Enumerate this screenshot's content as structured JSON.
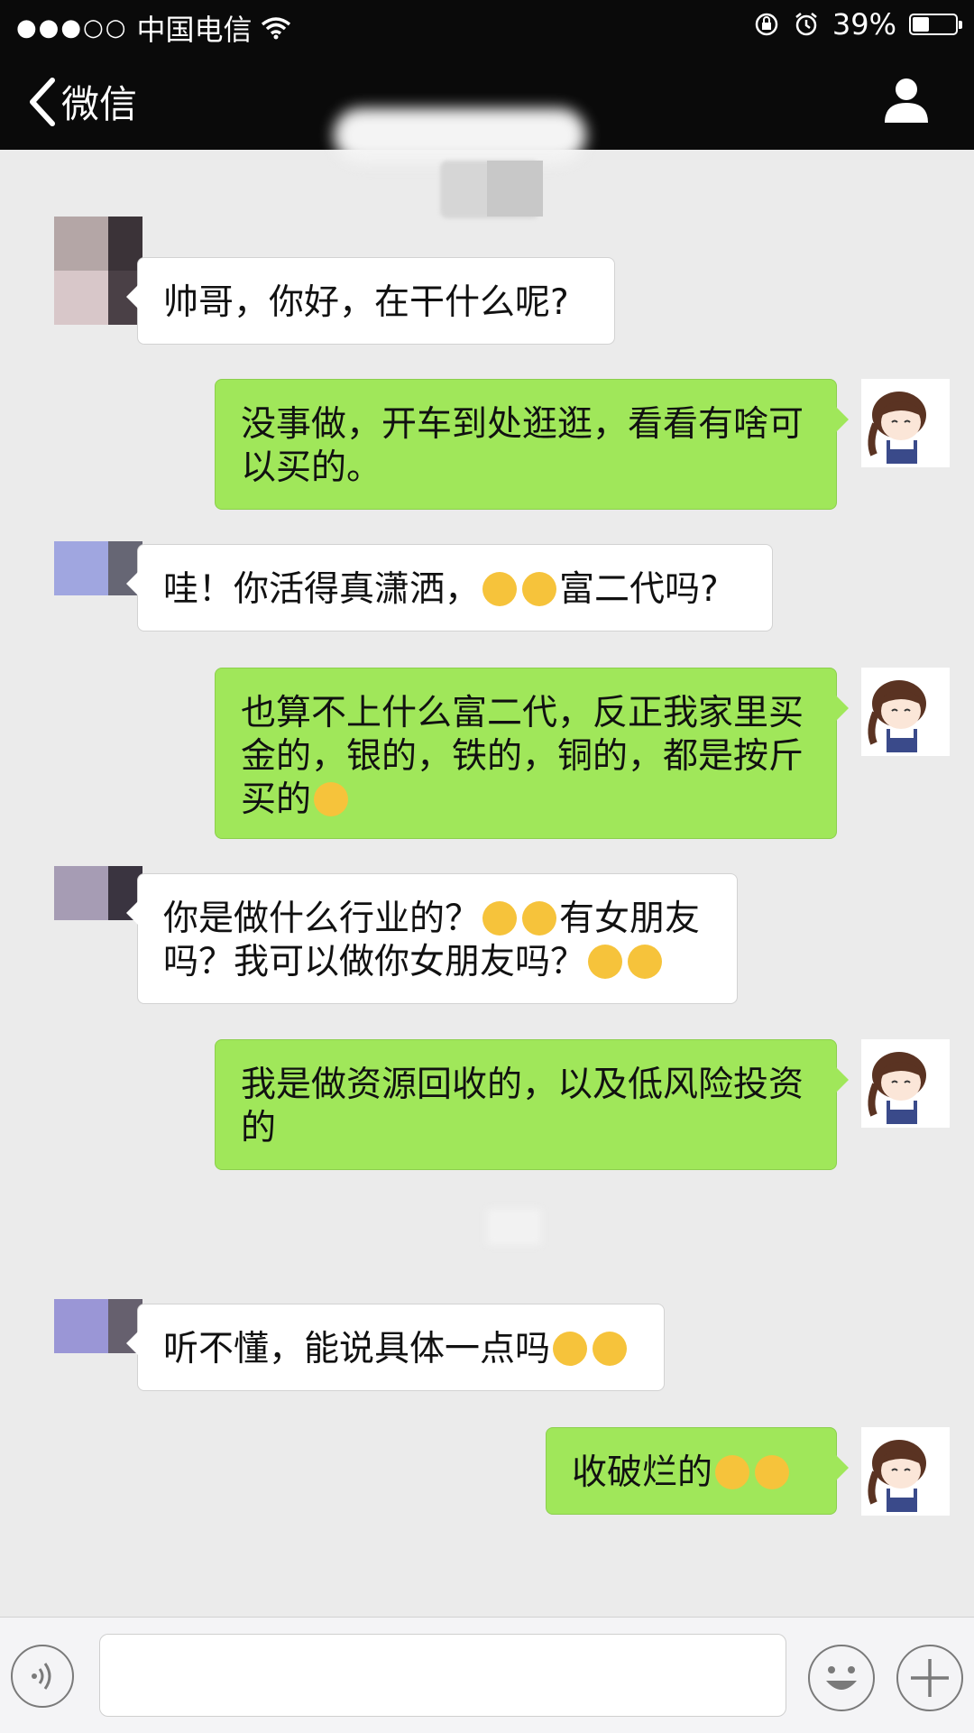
{
  "status_bar": {
    "signal": "●●●○○",
    "carrier": "中国电信",
    "battery_text": "39%",
    "battery_level": 0.39
  },
  "nav": {
    "back_label": "微信",
    "back_icon": "chevron-left-icon",
    "profile_icon": "person-icon"
  },
  "messages": [
    {
      "side": "in",
      "text": "帅哥，你好，在干什么呢?"
    },
    {
      "side": "out",
      "text": "没事做，开车到处逛逛，看看有啥可以买的。"
    },
    {
      "side": "in",
      "text": "哇！你活得真潇洒，",
      "emojis": [
        "kissing-face",
        "kissing-face"
      ],
      "text_after": "富二代吗?"
    },
    {
      "side": "out",
      "text": "也算不上什么富二代，反正我家里买金的，银的，铁的，铜的，都是按斤买的",
      "emojis_after": [
        "weary-face"
      ]
    },
    {
      "side": "in",
      "text": "你是做什么行业的？",
      "emojis": [
        "heart-eyes-face",
        "heart-eyes-face"
      ],
      "text_after": "有女朋友吗？我可以做你女朋友吗？",
      "emojis_end": [
        "wink-tongue-face",
        "wink-tongue-face"
      ]
    },
    {
      "side": "out",
      "text": "我是做资源回收的，以及低风险投资的"
    },
    {
      "side": "in",
      "text": "听不懂，能说具体一点吗",
      "emojis_after": [
        "blush-face",
        "blush-face"
      ]
    },
    {
      "side": "out",
      "text": "收破烂的",
      "emojis_after": [
        "tears-of-joy-face",
        "tears-of-joy-face"
      ]
    }
  ],
  "bottom_bar": {
    "input_value": "",
    "voice_icon": "voice-icon",
    "emoji_icon": "emoji-icon",
    "plus_icon": "plus-icon"
  },
  "colors": {
    "bar": "#0a0a0a",
    "background": "#ebebeb",
    "bubble_out": "#a0e75a",
    "bubble_in": "#ffffff"
  }
}
